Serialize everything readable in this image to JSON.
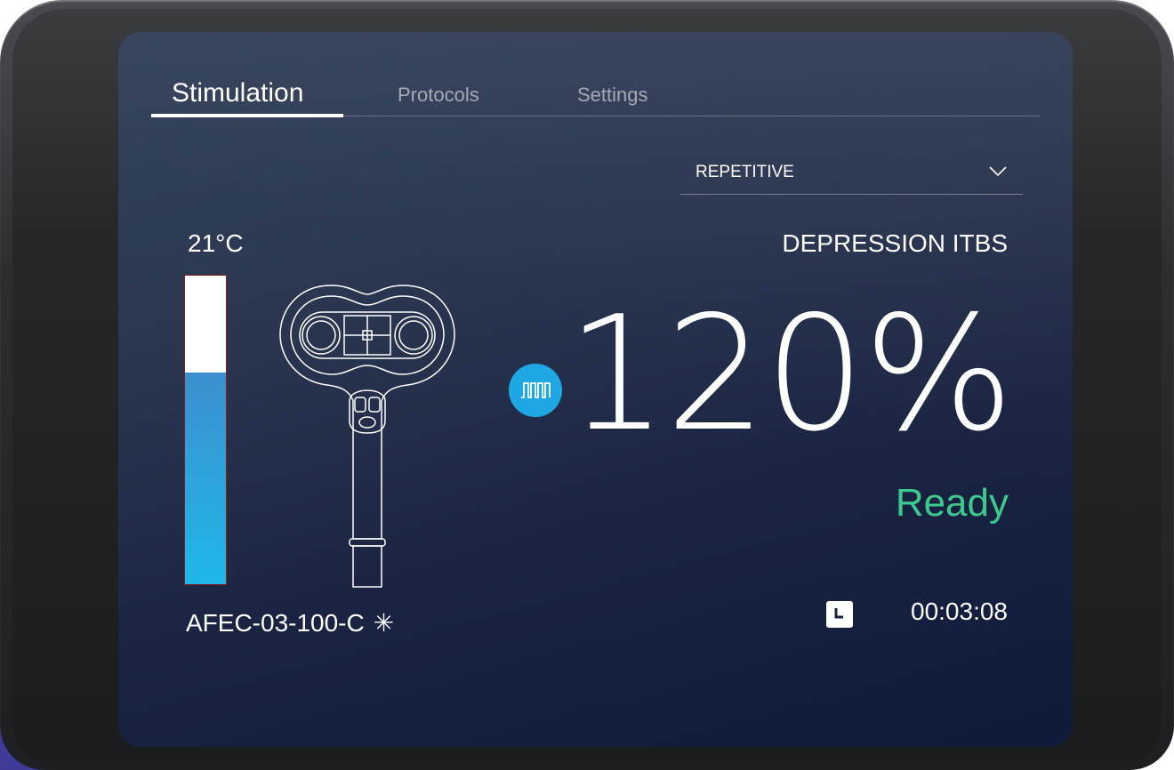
{
  "tabs": [
    {
      "label": "Stimulation",
      "active": true
    },
    {
      "label": "Protocols",
      "active": false
    },
    {
      "label": "Settings",
      "active": false
    }
  ],
  "mode_dropdown": {
    "selected": "REPETITIVE",
    "icon": "chevron-down-icon"
  },
  "protocol_name": "DEPRESSION ITBS",
  "temperature": "21°C",
  "temperature_level": 0.685,
  "intensity": "120%",
  "status": "Ready",
  "timer": "00:03:08",
  "coil_model": "AFEC-03-100-C",
  "coil_settings_symbol": "✳",
  "icons": [
    "pulse-train-icon",
    "clock-icon",
    "coil-icon",
    "asterisk-icon"
  ],
  "colors": {
    "accent": "#1ea7e2",
    "status_ready": "#3dc98e",
    "gauge_top": "#3c8fce",
    "gauge_bottom": "#1fb8e8",
    "screen_bg": "#1a2442"
  }
}
